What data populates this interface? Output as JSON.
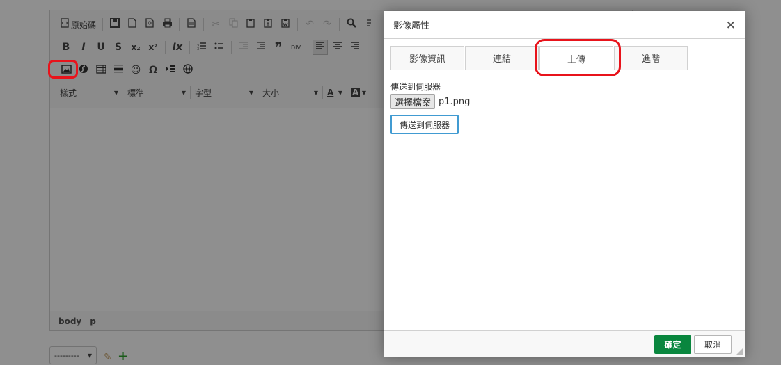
{
  "editor": {
    "toolbar_row1": {
      "source_label": "原始碼",
      "icons": [
        "source-icon",
        "save-icon",
        "new-page-icon",
        "preview-icon",
        "print-icon",
        "templates-icon",
        "cut-icon",
        "copy-icon",
        "paste-icon",
        "paste-text-icon",
        "paste-word-icon",
        "undo-icon",
        "redo-icon",
        "find-icon",
        "replace-icon"
      ]
    },
    "toolbar_row2": {
      "bold": "B",
      "italic": "I",
      "underline": "U",
      "strike": "S",
      "subscript": "x₂",
      "superscript": "x²",
      "remove_format": "Ix",
      "blockquote": "❞",
      "div": "DIV"
    },
    "toolbar_row3": {
      "icons": [
        "image-icon",
        "flash-icon",
        "table-icon",
        "horizontal-rule-icon",
        "smiley-icon",
        "special-char-icon",
        "page-break-icon",
        "iframe-icon"
      ],
      "omega": "Ω"
    },
    "combos": {
      "styles": "樣式",
      "format": "標準",
      "font": "字型",
      "size": "大小"
    },
    "path": [
      "body",
      "p"
    ]
  },
  "below_editor": {
    "select_value": "---------"
  },
  "dialog": {
    "title": "影像屬性",
    "close": "×",
    "tabs": [
      "影像資訊",
      "連結",
      "上傳",
      "進階"
    ],
    "selected_tab": "上傳",
    "upload": {
      "label": "傳送到伺服器",
      "file_button": "選擇檔案",
      "file_name": "p1.png",
      "send_button": "傳送到伺服器"
    },
    "ok_label": "確定",
    "cancel_label": "取消"
  },
  "colors": {
    "highlight": "#e8131b",
    "ok_button": "#09863e",
    "focus_border": "#419bd2"
  }
}
